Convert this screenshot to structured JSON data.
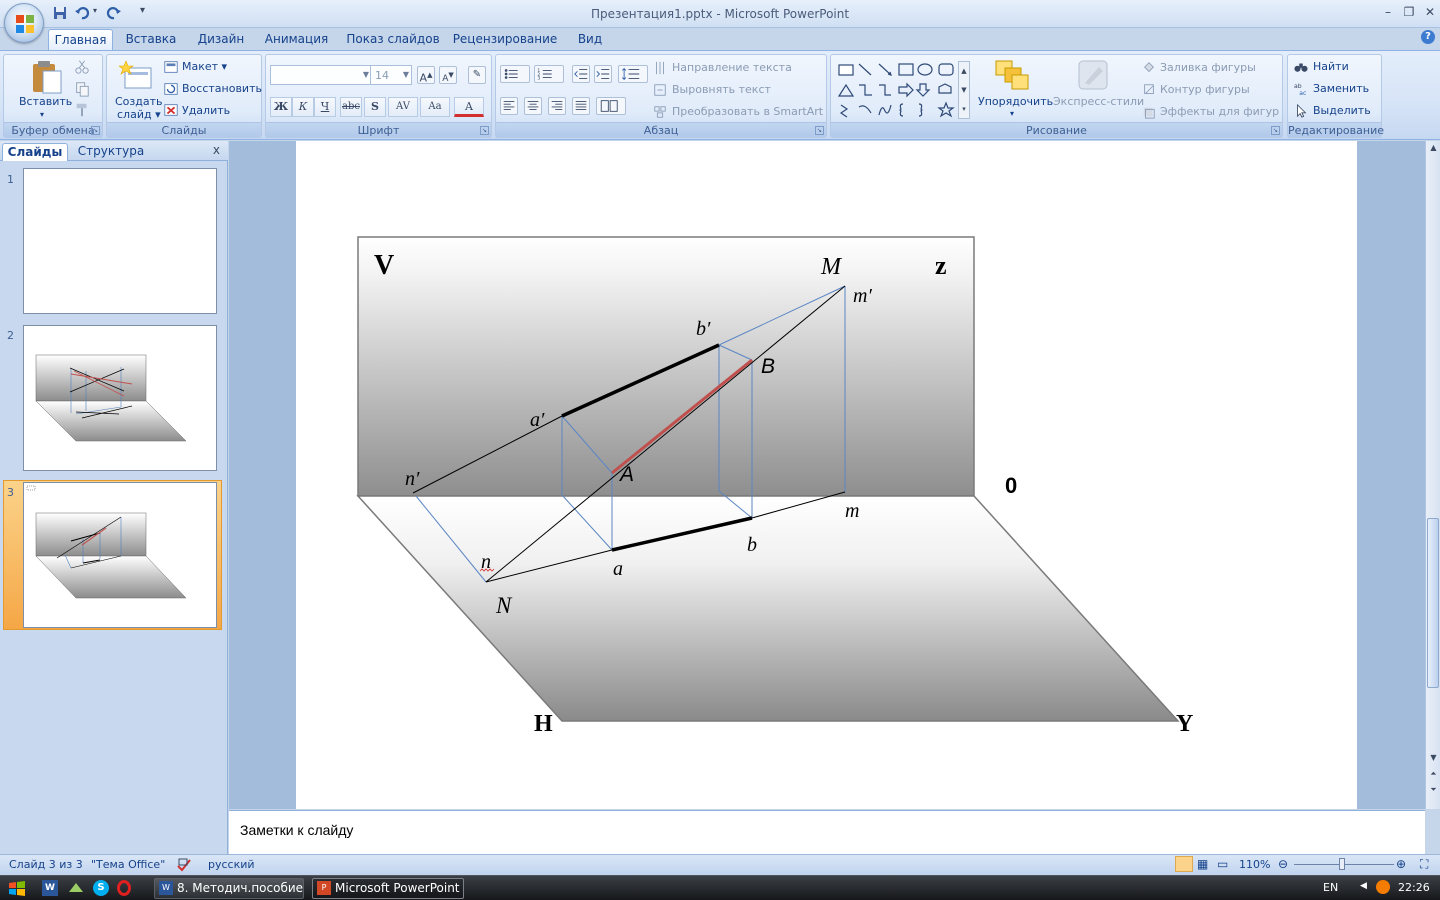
{
  "window": {
    "title": "Презентация1.pptx - Microsoft PowerPoint",
    "controls": {
      "minimize": "–",
      "restore": "❐",
      "close": "✕"
    }
  },
  "ribbon": {
    "tabs": [
      "Главная",
      "Вставка",
      "Дизайн",
      "Анимация",
      "Показ слайдов",
      "Рецензирование",
      "Вид"
    ],
    "active_tab": "Главная",
    "groups": {
      "clipboard": {
        "label": "Буфер обмена",
        "paste": "Вставить"
      },
      "slides": {
        "label": "Слайды",
        "new_slide_line1": "Создать",
        "new_slide_line2": "слайд ▾",
        "layout": "Макет ▾",
        "reset": "Восстановить",
        "delete": "Удалить"
      },
      "font": {
        "label": "Шрифт",
        "font_size": "14",
        "bold": "Ж",
        "italic": "К",
        "underline": "Ч",
        "strike": "abc",
        "shadow": "S",
        "spacing": "AV",
        "case": "Aa",
        "color": "A"
      },
      "paragraph": {
        "label": "Абзац",
        "text_direction": "Направление текста",
        "align_text": "Выровнять текст",
        "smartart": "Преобразовать в SmartArt"
      },
      "drawing": {
        "label": "Рисование",
        "arrange": "Упорядочить",
        "quick_styles": "Экспресс-стили",
        "shape_fill": "Заливка фигуры",
        "shape_outline": "Контур фигуры",
        "shape_effects": "Эффекты для фигур"
      },
      "editing": {
        "label": "Редактирование",
        "find": "Найти",
        "replace": "Заменить",
        "select": "Выделить"
      }
    }
  },
  "left_panel": {
    "tabs": [
      "Слайды",
      "Структура"
    ],
    "close": "x",
    "slides": [
      {
        "number": "1"
      },
      {
        "number": "2"
      },
      {
        "number": "3",
        "selected": true
      }
    ]
  },
  "slide": {
    "labels": {
      "V": "V",
      "z": "z",
      "M": "M",
      "m_prime": "m′",
      "b_prime": "b′",
      "B": "B",
      "a_prime": "a′",
      "A": "A",
      "n_prime": "n′",
      "zero": "0",
      "m": "m",
      "b": "b",
      "n": "n",
      "a": "a",
      "N": "N",
      "H": "H",
      "Y": "Y"
    },
    "colors": {
      "projection_lines": "#5b86c4",
      "segment_AB": "#c0504d",
      "bold_segments": "#000000"
    }
  },
  "notes": {
    "placeholder": "Заметки к слайду"
  },
  "status_bar": {
    "slide_info": "Слайд 3 из 3",
    "theme": "\"Тема Office\"",
    "language": "русский",
    "zoom": "110%"
  },
  "taskbar": {
    "tasks": [
      {
        "label": "8. Методич.пособие...",
        "icon": "word-icon"
      },
      {
        "label": "Microsoft PowerPoint ...",
        "icon": "powerpoint-icon",
        "active": true
      }
    ],
    "lang": "EN",
    "clock": "22:26"
  }
}
